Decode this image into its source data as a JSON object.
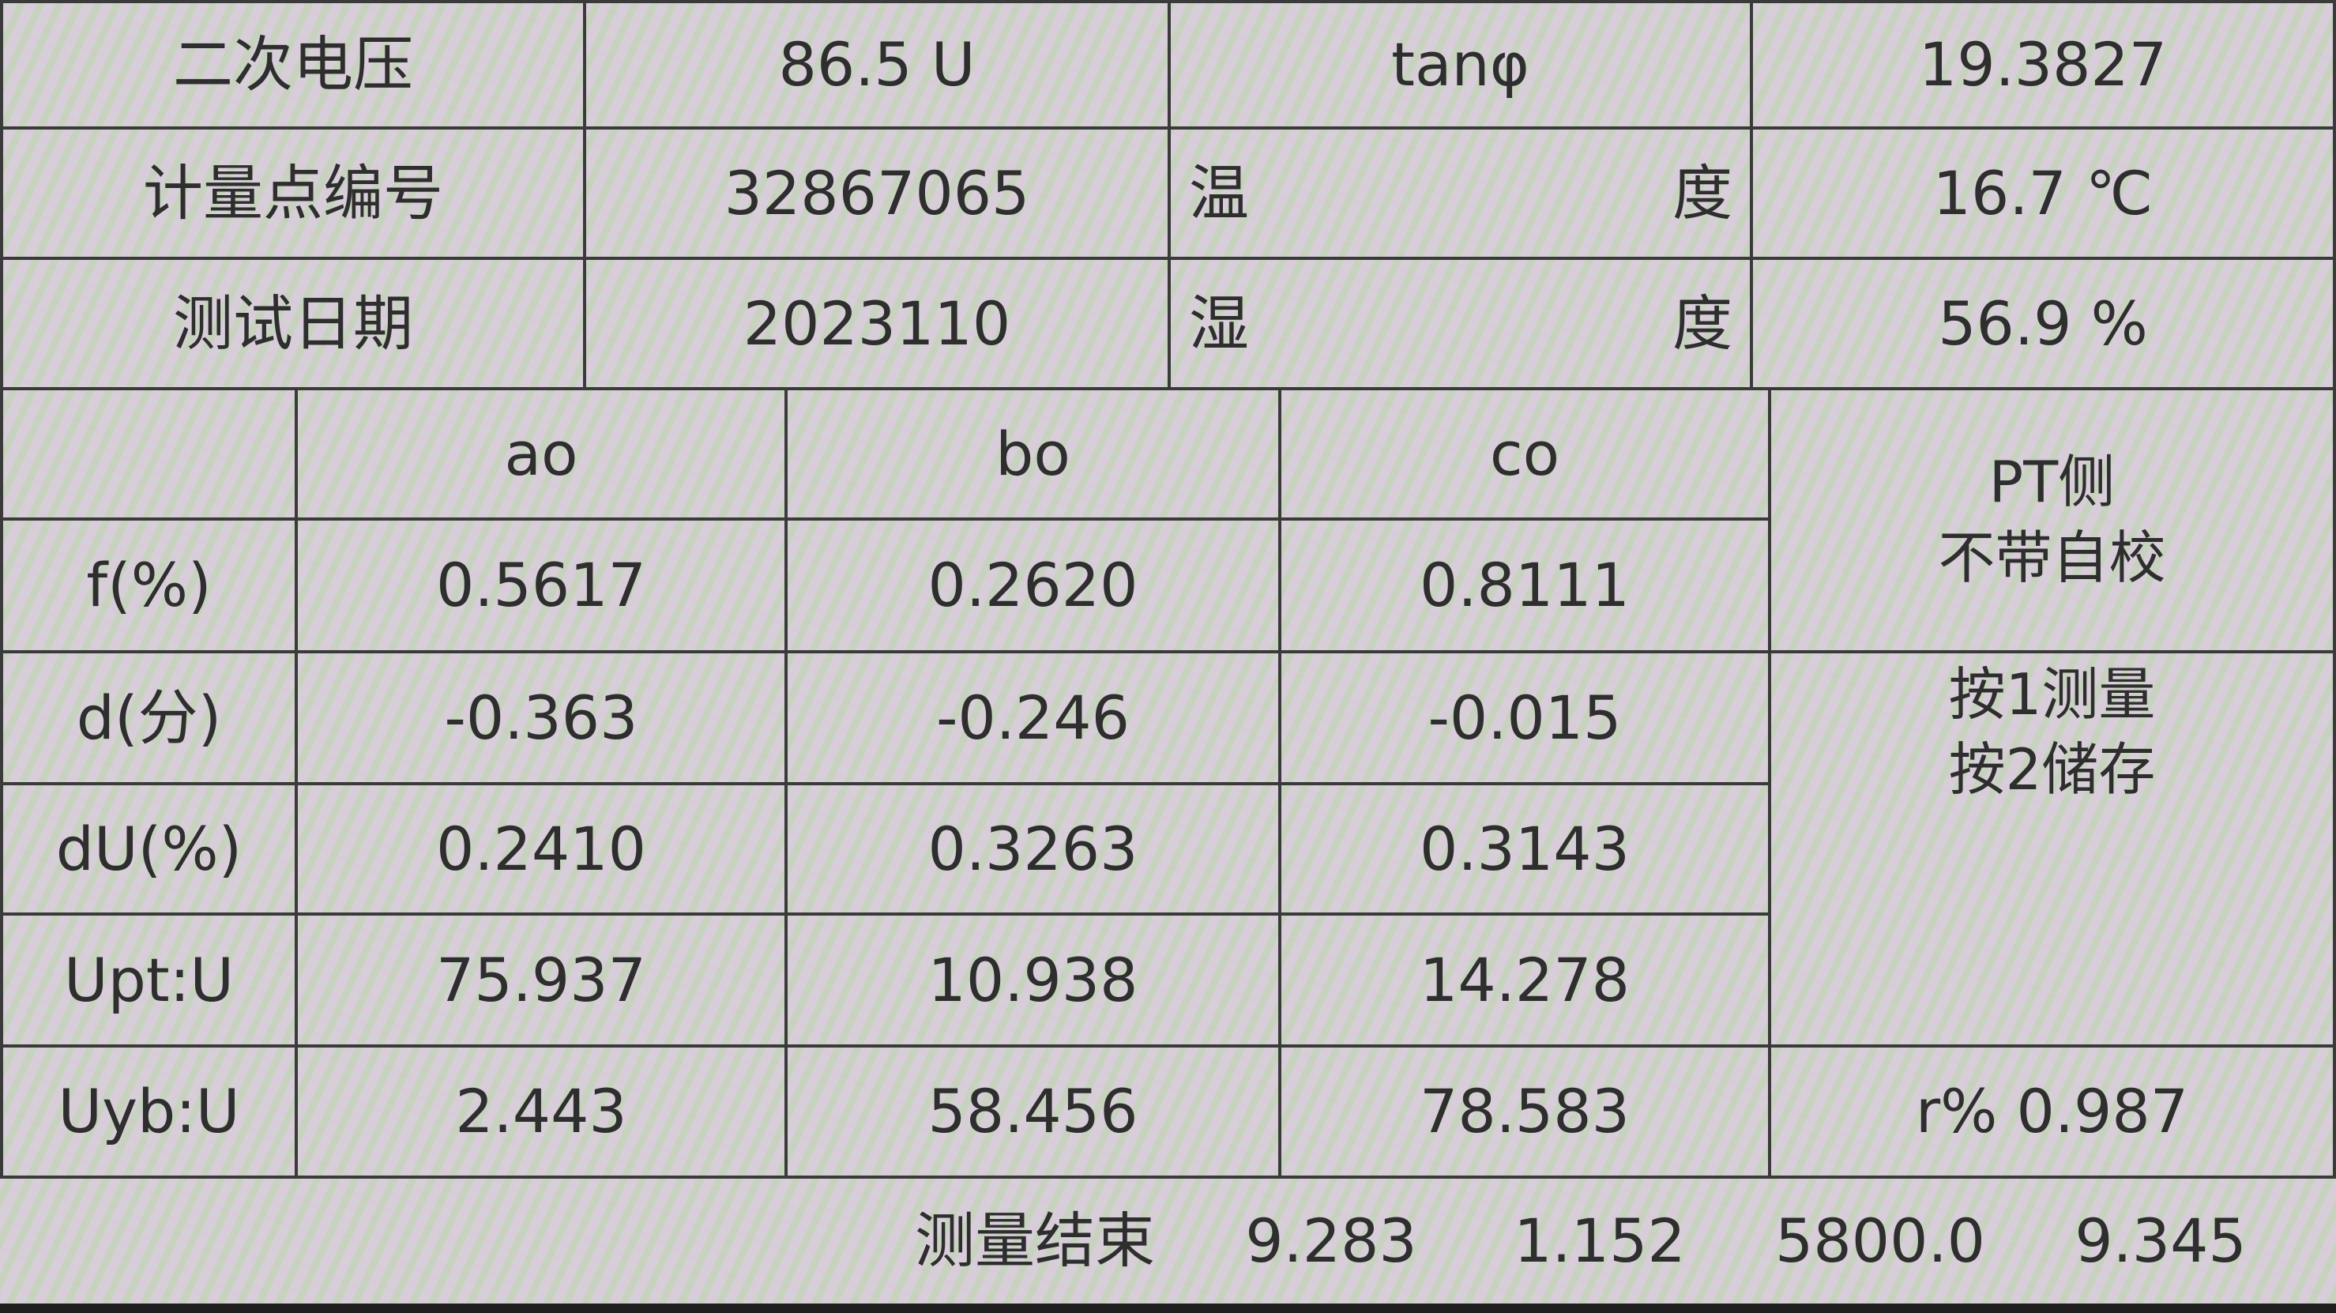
{
  "info": {
    "secondary_voltage_label": "二次电压",
    "secondary_voltage_value": "86.5 U",
    "tan_label": "tanφ",
    "tan_value": "19.3827",
    "point_no_label": "计量点编号",
    "point_no_value": "32867065",
    "temperature_label_a": "温",
    "temperature_label_b": "度",
    "temperature_value": "16.7 ℃",
    "test_date_label": "测试日期",
    "test_date_value": "2023110",
    "humidity_label_a": "湿",
    "humidity_label_b": "度",
    "humidity_value": "56.9 %"
  },
  "measurements": {
    "columns": [
      "ao",
      "bo",
      "co"
    ],
    "rows": [
      {
        "label": "f(%)",
        "values": [
          "0.5617",
          "0.2620",
          "0.8111"
        ]
      },
      {
        "label": "d(分)",
        "values": [
          "-0.363",
          "-0.246",
          "-0.015"
        ]
      },
      {
        "label": "dU(%)",
        "values": [
          "0.2410",
          "0.3263",
          "0.3143"
        ]
      },
      {
        "label": "Upt:U",
        "values": [
          "75.937",
          "10.938",
          "14.278"
        ]
      },
      {
        "label": "Uyb:U",
        "values": [
          "2.443",
          "58.456",
          "78.583"
        ]
      }
    ]
  },
  "side_panel": {
    "pt_line1": "PT侧",
    "pt_line2": "不带自校",
    "hint_line1": "按1测量",
    "hint_line2": "按2储存",
    "ratio": "r% 0.987"
  },
  "status": {
    "label": "测量结束",
    "values": [
      "9.283",
      "1.152",
      "5800.0",
      "9.345"
    ]
  }
}
